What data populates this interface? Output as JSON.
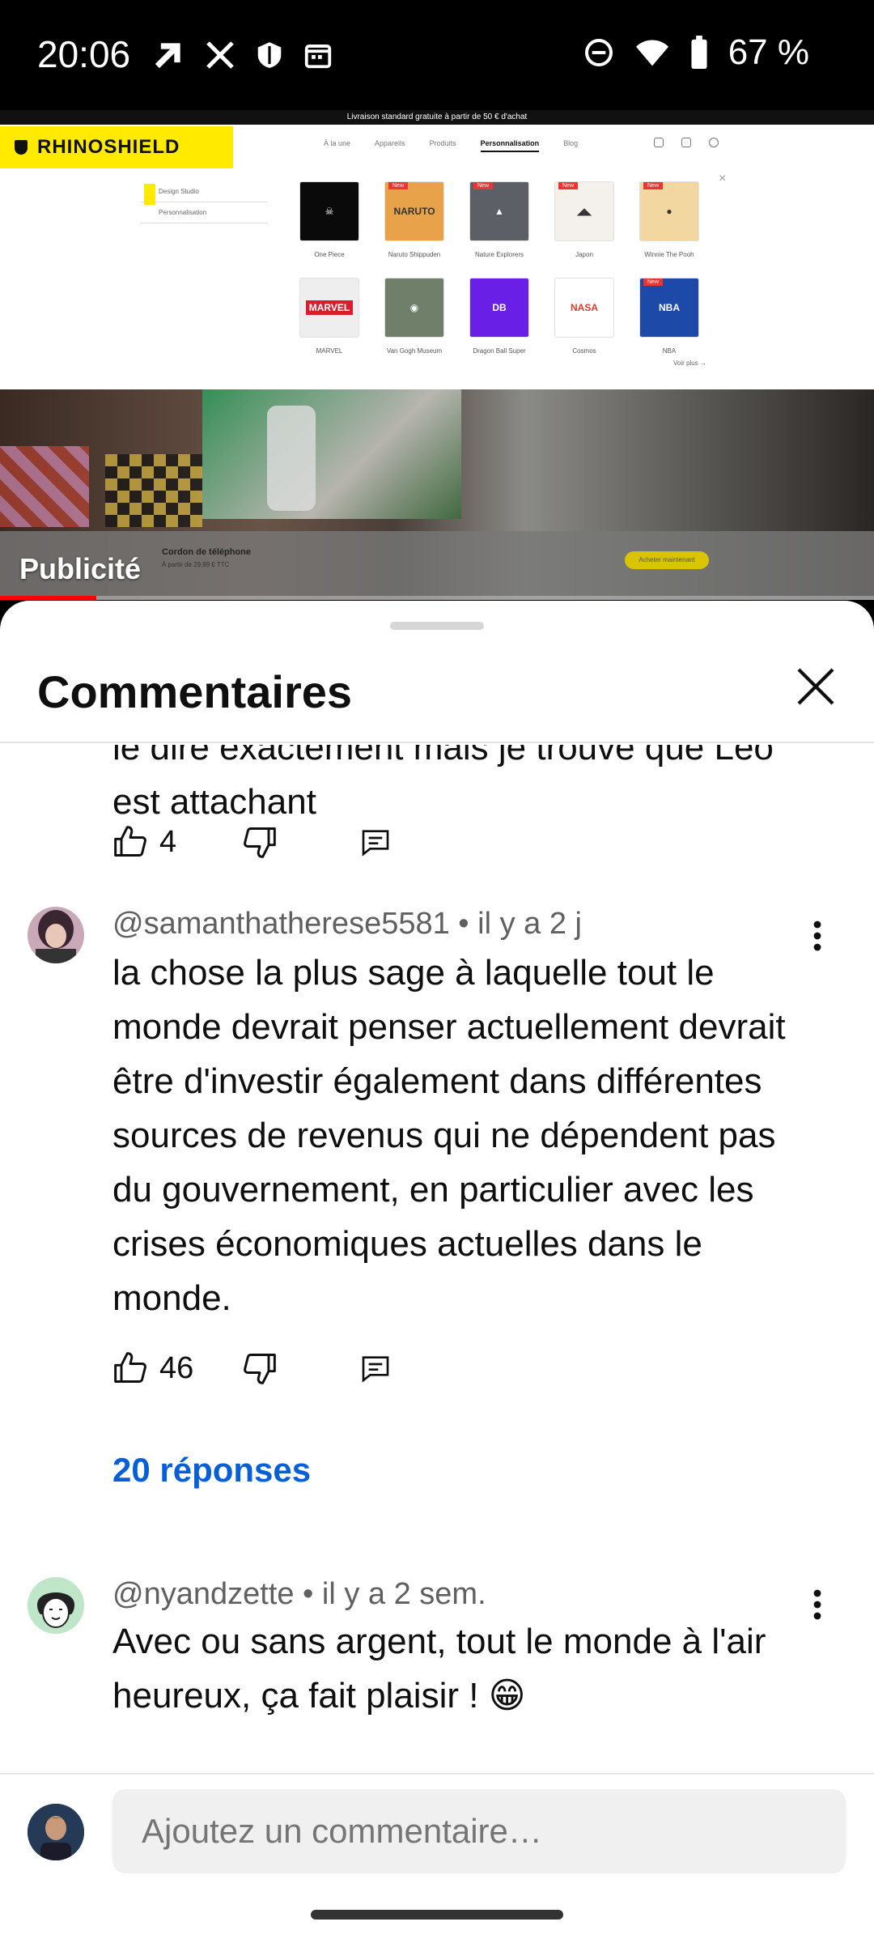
{
  "status_bar": {
    "time": "20:06",
    "battery_percent": "67 %",
    "left_icons": [
      "arrow-up-right-icon",
      "x-icon",
      "shield-icon",
      "calendar-icon"
    ],
    "right_icons": [
      "do-not-disturb-icon",
      "wifi-icon",
      "battery-icon"
    ]
  },
  "ad": {
    "topline": "Livraison standard gratuite à partir de 50 € d'achat",
    "brand": "RHINOSHIELD",
    "nav": [
      "À la une",
      "Appareils",
      "Produits",
      "Personnalisation",
      "Blog"
    ],
    "nav_active": "Personnalisation",
    "side_menu": [
      "Design Studio",
      "Personnalisation"
    ],
    "badge": "New",
    "tiles": [
      {
        "label": "One Piece",
        "new": false,
        "color": "#0a0a0a",
        "glyph": "☠"
      },
      {
        "label": "Naruto Shippuden",
        "new": true,
        "color": "#e8a34a",
        "glyph": "NARUTO"
      },
      {
        "label": "Nature Explorers",
        "new": true,
        "color": "#5c5f66",
        "glyph": "▲"
      },
      {
        "label": "Japon",
        "new": true,
        "color": "#f4f1ec",
        "glyph": "◢◣"
      },
      {
        "label": "Winnie The Pooh",
        "new": true,
        "color": "#f3d7a0",
        "glyph": "●"
      },
      {
        "label": "MARVEL",
        "new": false,
        "color": "#eeeeee",
        "glyph": "MARVEL"
      },
      {
        "label": "Van Gogh Museum",
        "new": false,
        "color": "#6f7f6a",
        "glyph": "◉"
      },
      {
        "label": "Dragon Ball Super",
        "new": false,
        "color": "#6a1fe6",
        "glyph": "DB"
      },
      {
        "label": "Cosmos",
        "new": false,
        "color": "#ffffff",
        "glyph": "NASA"
      },
      {
        "label": "NBA",
        "new": true,
        "color": "#1d4aa8",
        "glyph": "NBA"
      }
    ],
    "more": "Voir plus →",
    "strip_title": "Cordon de téléphone",
    "strip_sub": "À partir de 29,99 € TTC",
    "strip_button": "Acheter maintenant",
    "label": "Publicité",
    "progress": 0.11
  },
  "sheet": {
    "title": "Commentaires"
  },
  "comments": [
    {
      "text": "le dire exactement mais je trouve que Léo est attachant",
      "likes": "4",
      "truncated_top": true
    },
    {
      "author": "@samanthatherese5581",
      "time": "il y a 2 j",
      "meta": "@samanthatherese5581 • il y a 2 j",
      "text": "la chose la plus sage à laquelle tout le monde devrait penser actuellement devrait être d'investir également dans différentes sources de revenus qui ne dépendent pas du gouvernement, en particulier avec les crises économiques actuelles dans le monde.",
      "likes": "46",
      "replies": "20 réponses"
    },
    {
      "author": "@nyandzette",
      "time": "il y a 2 sem.",
      "meta": "@nyandzette • il y a 2 sem.",
      "text": "Avec ou sans argent, tout le monde à l'air heureux, ça fait plaisir ! 😁"
    }
  ],
  "composer": {
    "placeholder": "Ajoutez un commentaire…"
  }
}
